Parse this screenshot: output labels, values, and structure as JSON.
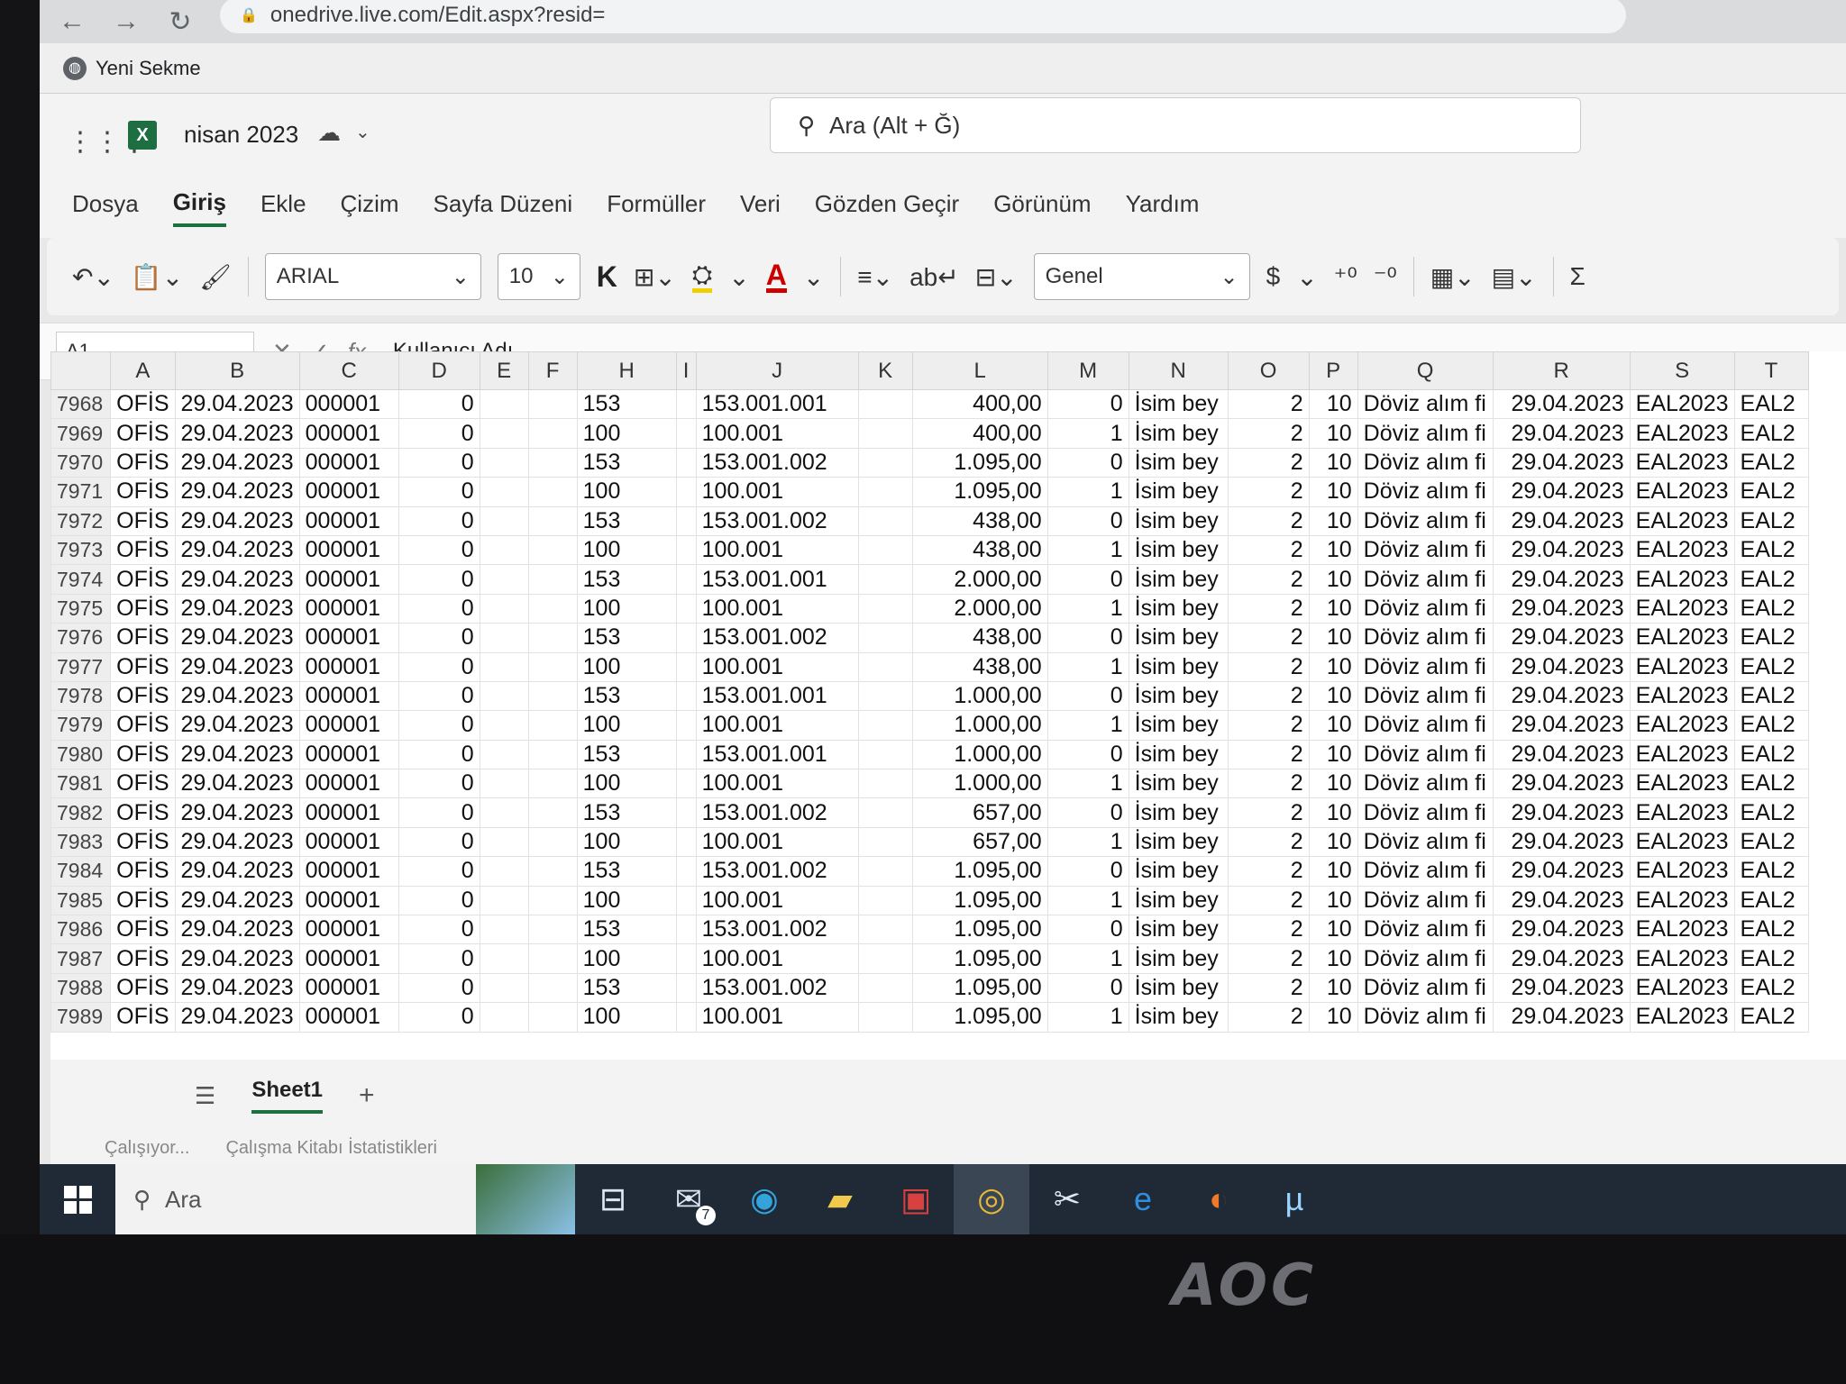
{
  "browser": {
    "url": "onedrive.live.com/Edit.aspx?resid=",
    "bookmark_label": "Yeni Sekme"
  },
  "app": {
    "doc_title": "nisan 2023",
    "search_placeholder": "Ara (Alt + Ğ)"
  },
  "ribbon_tabs": [
    "Dosya",
    "Giriş",
    "Ekle",
    "Çizim",
    "Sayfa Düzeni",
    "Formüller",
    "Veri",
    "Gözden Geçir",
    "Görünüm",
    "Yardım"
  ],
  "toolbar": {
    "font_name": "ARIAL",
    "font_size": "10",
    "bold_label": "K",
    "color_label": "A",
    "number_format": "Genel",
    "currency": "$",
    "sigma": "Σ"
  },
  "formula_bar": {
    "name_box": "A1",
    "fx": "fx",
    "content": "Kullanıcı Adı"
  },
  "columns": [
    "A",
    "B",
    "C",
    "D",
    "E",
    "F",
    "H",
    "I",
    "J",
    "K",
    "L",
    "M",
    "N",
    "O",
    "P",
    "Q",
    "R",
    "S",
    "T"
  ],
  "rows": [
    [
      "7968",
      "OFİS",
      "29.04.2023",
      "000001",
      "0",
      "",
      "",
      "153",
      "",
      "153.001.001",
      "",
      "400,00",
      "0",
      "İsim bey",
      "2",
      "10",
      "Döviz alım fi",
      "29.04.2023",
      "EAL2023",
      "EAL2"
    ],
    [
      "7969",
      "OFİS",
      "29.04.2023",
      "000001",
      "0",
      "",
      "",
      "100",
      "",
      "100.001",
      "",
      "400,00",
      "1",
      "İsim bey",
      "2",
      "10",
      "Döviz alım fi",
      "29.04.2023",
      "EAL2023",
      "EAL2"
    ],
    [
      "7970",
      "OFİS",
      "29.04.2023",
      "000001",
      "0",
      "",
      "",
      "153",
      "",
      "153.001.002",
      "",
      "1.095,00",
      "0",
      "İsim bey",
      "2",
      "10",
      "Döviz alım fi",
      "29.04.2023",
      "EAL2023",
      "EAL2"
    ],
    [
      "7971",
      "OFİS",
      "29.04.2023",
      "000001",
      "0",
      "",
      "",
      "100",
      "",
      "100.001",
      "",
      "1.095,00",
      "1",
      "İsim bey",
      "2",
      "10",
      "Döviz alım fi",
      "29.04.2023",
      "EAL2023",
      "EAL2"
    ],
    [
      "7972",
      "OFİS",
      "29.04.2023",
      "000001",
      "0",
      "",
      "",
      "153",
      "",
      "153.001.002",
      "",
      "438,00",
      "0",
      "İsim bey",
      "2",
      "10",
      "Döviz alım fi",
      "29.04.2023",
      "EAL2023",
      "EAL2"
    ],
    [
      "7973",
      "OFİS",
      "29.04.2023",
      "000001",
      "0",
      "",
      "",
      "100",
      "",
      "100.001",
      "",
      "438,00",
      "1",
      "İsim bey",
      "2",
      "10",
      "Döviz alım fi",
      "29.04.2023",
      "EAL2023",
      "EAL2"
    ],
    [
      "7974",
      "OFİS",
      "29.04.2023",
      "000001",
      "0",
      "",
      "",
      "153",
      "",
      "153.001.001",
      "",
      "2.000,00",
      "0",
      "İsim bey",
      "2",
      "10",
      "Döviz alım fi",
      "29.04.2023",
      "EAL2023",
      "EAL2"
    ],
    [
      "7975",
      "OFİS",
      "29.04.2023",
      "000001",
      "0",
      "",
      "",
      "100",
      "",
      "100.001",
      "",
      "2.000,00",
      "1",
      "İsim bey",
      "2",
      "10",
      "Döviz alım fi",
      "29.04.2023",
      "EAL2023",
      "EAL2"
    ],
    [
      "7976",
      "OFİS",
      "29.04.2023",
      "000001",
      "0",
      "",
      "",
      "153",
      "",
      "153.001.002",
      "",
      "438,00",
      "0",
      "İsim bey",
      "2",
      "10",
      "Döviz alım fi",
      "29.04.2023",
      "EAL2023",
      "EAL2"
    ],
    [
      "7977",
      "OFİS",
      "29.04.2023",
      "000001",
      "0",
      "",
      "",
      "100",
      "",
      "100.001",
      "",
      "438,00",
      "1",
      "İsim bey",
      "2",
      "10",
      "Döviz alım fi",
      "29.04.2023",
      "EAL2023",
      "EAL2"
    ],
    [
      "7978",
      "OFİS",
      "29.04.2023",
      "000001",
      "0",
      "",
      "",
      "153",
      "",
      "153.001.001",
      "",
      "1.000,00",
      "0",
      "İsim bey",
      "2",
      "10",
      "Döviz alım fi",
      "29.04.2023",
      "EAL2023",
      "EAL2"
    ],
    [
      "7979",
      "OFİS",
      "29.04.2023",
      "000001",
      "0",
      "",
      "",
      "100",
      "",
      "100.001",
      "",
      "1.000,00",
      "1",
      "İsim bey",
      "2",
      "10",
      "Döviz alım fi",
      "29.04.2023",
      "EAL2023",
      "EAL2"
    ],
    [
      "7980",
      "OFİS",
      "29.04.2023",
      "000001",
      "0",
      "",
      "",
      "153",
      "",
      "153.001.001",
      "",
      "1.000,00",
      "0",
      "İsim bey",
      "2",
      "10",
      "Döviz alım fi",
      "29.04.2023",
      "EAL2023",
      "EAL2"
    ],
    [
      "7981",
      "OFİS",
      "29.04.2023",
      "000001",
      "0",
      "",
      "",
      "100",
      "",
      "100.001",
      "",
      "1.000,00",
      "1",
      "İsim bey",
      "2",
      "10",
      "Döviz alım fi",
      "29.04.2023",
      "EAL2023",
      "EAL2"
    ],
    [
      "7982",
      "OFİS",
      "29.04.2023",
      "000001",
      "0",
      "",
      "",
      "153",
      "",
      "153.001.002",
      "",
      "657,00",
      "0",
      "İsim bey",
      "2",
      "10",
      "Döviz alım fi",
      "29.04.2023",
      "EAL2023",
      "EAL2"
    ],
    [
      "7983",
      "OFİS",
      "29.04.2023",
      "000001",
      "0",
      "",
      "",
      "100",
      "",
      "100.001",
      "",
      "657,00",
      "1",
      "İsim bey",
      "2",
      "10",
      "Döviz alım fi",
      "29.04.2023",
      "EAL2023",
      "EAL2"
    ],
    [
      "7984",
      "OFİS",
      "29.04.2023",
      "000001",
      "0",
      "",
      "",
      "153",
      "",
      "153.001.002",
      "",
      "1.095,00",
      "0",
      "İsim bey",
      "2",
      "10",
      "Döviz alım fi",
      "29.04.2023",
      "EAL2023",
      "EAL2"
    ],
    [
      "7985",
      "OFİS",
      "29.04.2023",
      "000001",
      "0",
      "",
      "",
      "100",
      "",
      "100.001",
      "",
      "1.095,00",
      "1",
      "İsim bey",
      "2",
      "10",
      "Döviz alım fi",
      "29.04.2023",
      "EAL2023",
      "EAL2"
    ],
    [
      "7986",
      "OFİS",
      "29.04.2023",
      "000001",
      "0",
      "",
      "",
      "153",
      "",
      "153.001.002",
      "",
      "1.095,00",
      "0",
      "İsim bey",
      "2",
      "10",
      "Döviz alım fi",
      "29.04.2023",
      "EAL2023",
      "EAL2"
    ],
    [
      "7987",
      "OFİS",
      "29.04.2023",
      "000001",
      "0",
      "",
      "",
      "100",
      "",
      "100.001",
      "",
      "1.095,00",
      "1",
      "İsim bey",
      "2",
      "10",
      "Döviz alım fi",
      "29.04.2023",
      "EAL2023",
      "EAL2"
    ],
    [
      "7988",
      "OFİS",
      "29.04.2023",
      "000001",
      "0",
      "",
      "",
      "153",
      "",
      "153.001.002",
      "",
      "1.095,00",
      "0",
      "İsim bey",
      "2",
      "10",
      "Döviz alım fi",
      "29.04.2023",
      "EAL2023",
      "EAL2"
    ],
    [
      "7989",
      "OFİS",
      "29.04.2023",
      "000001",
      "0",
      "",
      "",
      "100",
      "",
      "100.001",
      "",
      "1.095,00",
      "1",
      "İsim bey",
      "2",
      "10",
      "Döviz alım fi",
      "29.04.2023",
      "EAL2023",
      "EAL2"
    ]
  ],
  "sheet_tabs": [
    "Sheet1"
  ],
  "status": {
    "working": "Çalışıyor...",
    "stats": "Çalışma Kitabı İstatistikleri"
  },
  "taskbar": {
    "search_label": "Ara",
    "mail_badge": "7",
    "icons": [
      "task-view-icon",
      "mail-icon",
      "edge-icon",
      "file-explorer-icon",
      "photo-app-icon",
      "chrome-icon",
      "snipping-tool-icon",
      "internet-explorer-icon",
      "firefox-icon",
      "utorrent-icon"
    ]
  },
  "monitor": {
    "brand": "AOC"
  },
  "colors": {
    "excel_green": "#1d6f42",
    "font_color_red": "#c00000",
    "highlight_yellow": "#f0d000",
    "taskbar": "#1f2a36"
  }
}
